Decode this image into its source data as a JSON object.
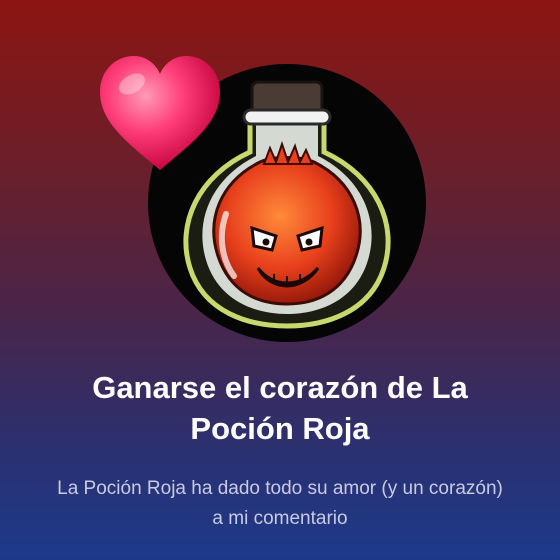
{
  "achievement": {
    "title": "Ganarse el corazón de La Poción Roja",
    "description": "La Poción Roja ha dado todo su amor (y un corazón) a mi comentario",
    "icon": "red-potion-avatar",
    "badge_icon": "heart-icon"
  },
  "colors": {
    "bg_top": "#8c1512",
    "bg_bottom": "#1d3a8a",
    "title": "#ffffff",
    "description": "#c9cbe3",
    "heart": "#ff2d6e",
    "potion": "#e8401c"
  }
}
